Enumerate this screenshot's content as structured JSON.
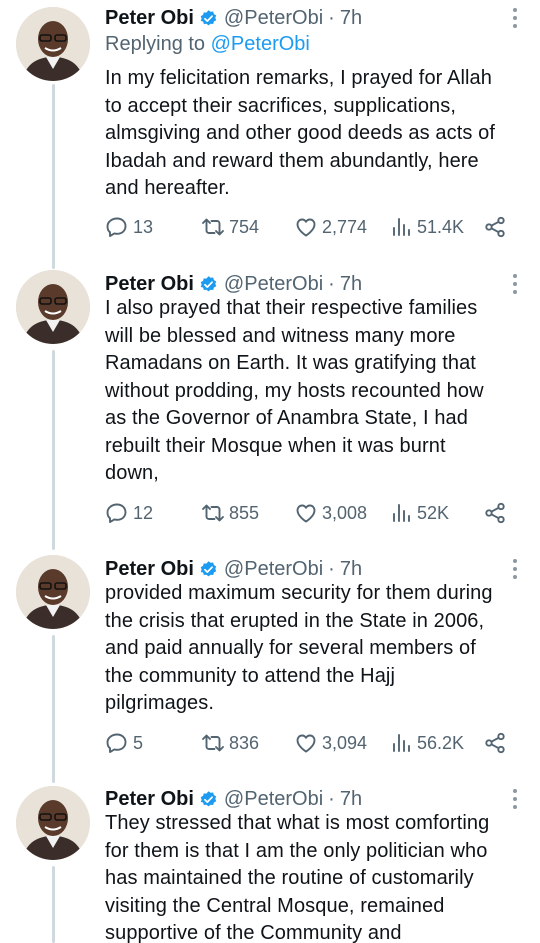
{
  "colors": {
    "accent": "#1d9bf0",
    "text": "#0f1419",
    "muted": "#536471",
    "thread_line": "#cfd9de"
  },
  "author": {
    "name": "Peter Obi",
    "handle": "@PeterObi",
    "time": "7h",
    "separator": "·"
  },
  "tweets": [
    {
      "reply_prefix": "Replying to ",
      "reply_mention": "@PeterObi",
      "text": "In my felicitation remarks, I prayed for Allah\nto accept their sacrifices, supplications,\nalmsgiving and other good deeds as acts of\nIbadah and reward them abundantly, here\nand hereafter.",
      "replies": "13",
      "retweets": "754",
      "likes": "2,774",
      "views": "51.4K"
    },
    {
      "text": "I also prayed that their respective families\nwill be blessed and witness many more\nRamadans on Earth.  It was gratifying that\nwithout prodding, my hosts recounted how\nas the Governor of Anambra State, I had\nrebuilt their Mosque when it was burnt\ndown,",
      "replies": "12",
      "retweets": "855",
      "likes": "3,008",
      "views": "52K"
    },
    {
      "text": "provided maximum security for them during\nthe crisis that erupted in the State in 2006,\nand paid annually for several members of\nthe community to attend the Hajj\npilgrimages.",
      "replies": "5",
      "retweets": "836",
      "likes": "3,094",
      "views": "56.2K"
    },
    {
      "text": "They stressed that what is most comforting\nfor them is that I am the only politician who\nhas maintained the routine of customarily\nvisiting the Central Mosque, remained\nsupportive of the Community and"
    }
  ],
  "icons": {
    "reply": "reply-icon",
    "retweet": "retweet-icon",
    "like": "heart-icon",
    "views": "views-icon",
    "share": "share-icon",
    "verified": "verified-badge-icon",
    "more": "more-icon"
  }
}
